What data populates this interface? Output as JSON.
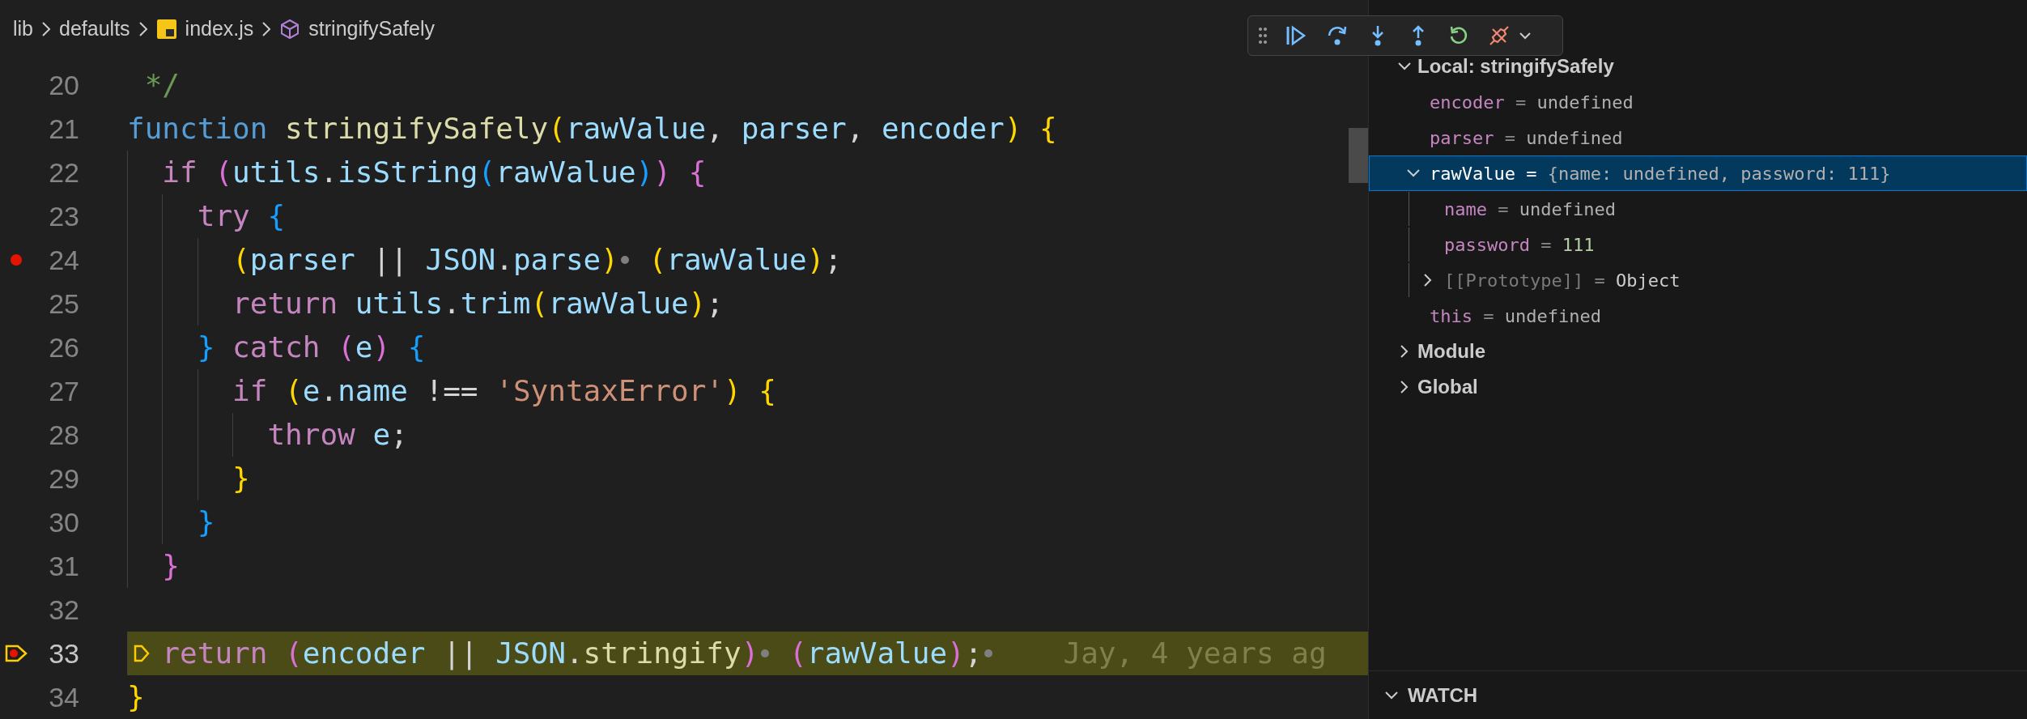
{
  "breadcrumbs": [
    {
      "kind": "folder",
      "label": "lib"
    },
    {
      "kind": "folder",
      "label": "defaults"
    },
    {
      "kind": "file",
      "label": "index.js"
    },
    {
      "kind": "symbol",
      "label": "stringifySafely"
    }
  ],
  "debug_toolbar": [
    {
      "kind": "continue"
    },
    {
      "kind": "step-over"
    },
    {
      "kind": "step-into"
    },
    {
      "kind": "step-out"
    },
    {
      "kind": "restart"
    },
    {
      "kind": "disconnect"
    }
  ],
  "editor": {
    "lines": [
      {
        "number": "20",
        "breakpoint": false,
        "current": false,
        "tokens": [
          {
            "kind": "comment",
            "text": " */"
          }
        ]
      },
      {
        "number": "21",
        "breakpoint": false,
        "current": false,
        "tokens": [
          {
            "kind": "keyword",
            "text": "function "
          },
          {
            "kind": "function",
            "text": "stringifySafely"
          },
          {
            "kind": "bracket-gold",
            "text": "("
          },
          {
            "kind": "variable",
            "text": "rawValue"
          },
          {
            "kind": "plain",
            "text": ", "
          },
          {
            "kind": "variable",
            "text": "parser"
          },
          {
            "kind": "plain",
            "text": ", "
          },
          {
            "kind": "variable",
            "text": "encoder"
          },
          {
            "kind": "bracket-gold",
            "text": ") {"
          }
        ]
      },
      {
        "number": "22",
        "breakpoint": false,
        "current": false,
        "tokens": [
          {
            "kind": "control",
            "text": "  if "
          },
          {
            "kind": "bracket-pink",
            "text": "("
          },
          {
            "kind": "variable",
            "text": "utils"
          },
          {
            "kind": "plain",
            "text": "."
          },
          {
            "kind": "variable",
            "text": "isString"
          },
          {
            "kind": "bracket-blue",
            "text": "("
          },
          {
            "kind": "variable",
            "text": "rawValue"
          },
          {
            "kind": "bracket-blue",
            "text": ")"
          },
          {
            "kind": "bracket-pink",
            "text": ") {"
          }
        ]
      },
      {
        "number": "23",
        "breakpoint": false,
        "current": false,
        "tokens": [
          {
            "kind": "control",
            "text": "    try "
          },
          {
            "kind": "bracket-blue",
            "text": "{"
          }
        ]
      },
      {
        "number": "24",
        "breakpoint": true,
        "current": false,
        "tokens": [
          {
            "kind": "bracket-gold",
            "text": "      ("
          },
          {
            "kind": "variable",
            "text": "parser"
          },
          {
            "kind": "plain",
            "text": " || "
          },
          {
            "kind": "variable",
            "text": "JSON"
          },
          {
            "kind": "plain",
            "text": "."
          },
          {
            "kind": "variable",
            "text": "parse"
          },
          {
            "kind": "bracket-gold",
            "text": ")"
          },
          {
            "kind": "inline-breakpoint"
          },
          {
            "kind": "bracket-gold",
            "text": " ("
          },
          {
            "kind": "variable",
            "text": "rawValue"
          },
          {
            "kind": "bracket-gold",
            "text": ")"
          },
          {
            "kind": "plain",
            "text": ";"
          }
        ]
      },
      {
        "number": "25",
        "breakpoint": false,
        "current": false,
        "tokens": [
          {
            "kind": "control",
            "text": "      return "
          },
          {
            "kind": "variable",
            "text": "utils"
          },
          {
            "kind": "plain",
            "text": "."
          },
          {
            "kind": "variable",
            "text": "trim"
          },
          {
            "kind": "bracket-gold",
            "text": "("
          },
          {
            "kind": "variable",
            "text": "rawValue"
          },
          {
            "kind": "bracket-gold",
            "text": ")"
          },
          {
            "kind": "plain",
            "text": ";"
          }
        ]
      },
      {
        "number": "26",
        "breakpoint": false,
        "current": false,
        "tokens": [
          {
            "kind": "bracket-blue",
            "text": "    } "
          },
          {
            "kind": "control",
            "text": "catch "
          },
          {
            "kind": "bracket-pink",
            "text": "("
          },
          {
            "kind": "variable",
            "text": "e"
          },
          {
            "kind": "bracket-pink",
            "text": ") "
          },
          {
            "kind": "bracket-blue",
            "text": "{"
          }
        ]
      },
      {
        "number": "27",
        "breakpoint": false,
        "current": false,
        "tokens": [
          {
            "kind": "control",
            "text": "      if "
          },
          {
            "kind": "bracket-gold",
            "text": "("
          },
          {
            "kind": "variable",
            "text": "e"
          },
          {
            "kind": "plain",
            "text": "."
          },
          {
            "kind": "variable",
            "text": "name"
          },
          {
            "kind": "plain",
            "text": " !== "
          },
          {
            "kind": "string",
            "text": "'SyntaxError'"
          },
          {
            "kind": "bracket-gold",
            "text": ") {"
          }
        ]
      },
      {
        "number": "28",
        "breakpoint": false,
        "current": false,
        "tokens": [
          {
            "kind": "control",
            "text": "        throw "
          },
          {
            "kind": "variable",
            "text": "e"
          },
          {
            "kind": "plain",
            "text": ";"
          }
        ]
      },
      {
        "number": "29",
        "breakpoint": false,
        "current": false,
        "tokens": [
          {
            "kind": "bracket-gold",
            "text": "      }"
          }
        ]
      },
      {
        "number": "30",
        "breakpoint": false,
        "current": false,
        "tokens": [
          {
            "kind": "bracket-blue",
            "text": "    }"
          }
        ]
      },
      {
        "number": "31",
        "breakpoint": false,
        "current": false,
        "tokens": [
          {
            "kind": "bracket-pink",
            "text": "  }"
          }
        ]
      },
      {
        "number": "32",
        "breakpoint": false,
        "current": false
      },
      {
        "number": "33",
        "breakpoint": true,
        "current": true,
        "blame": "Jay, 4 years ag",
        "tokens": [
          {
            "kind": "control",
            "text": "  return "
          },
          {
            "kind": "bracket-pink",
            "text": "("
          },
          {
            "kind": "variable",
            "text": "encoder"
          },
          {
            "kind": "plain",
            "text": " || "
          },
          {
            "kind": "variable",
            "text": "JSON"
          },
          {
            "kind": "plain",
            "text": "."
          },
          {
            "kind": "function",
            "text": "stringify"
          },
          {
            "kind": "bracket-pink",
            "text": ")"
          },
          {
            "kind": "inline-breakpoint"
          },
          {
            "kind": "bracket-pink",
            "text": " ("
          },
          {
            "kind": "variable",
            "text": "rawValue"
          },
          {
            "kind": "bracket-pink",
            "text": ")"
          },
          {
            "kind": "plain",
            "text": ";"
          },
          {
            "kind": "inline-breakpoint"
          }
        ]
      },
      {
        "number": "34",
        "breakpoint": false,
        "current": false,
        "tokens": [
          {
            "kind": "bracket-gold",
            "text": "}"
          }
        ]
      }
    ]
  },
  "variables": {
    "scopes": [
      {
        "label": "Local: stringifySafely",
        "expanded": true,
        "children": [
          {
            "kind": "variable",
            "name": "encoder",
            "separator": "=",
            "value": "undefined",
            "selected": false
          },
          {
            "kind": "variable",
            "name": "parser",
            "separator": "=",
            "value": "undefined",
            "selected": false
          },
          {
            "kind": "variable",
            "name": "rawValue",
            "separator": "=",
            "value": "{name: undefined, password: 111}",
            "expanded": true,
            "selected": true,
            "children": [
              {
                "kind": "variable",
                "name": "name",
                "separator": "=",
                "value": "undefined",
                "selected": false
              },
              {
                "kind": "number",
                "name": "password",
                "separator": "=",
                "value": "111",
                "selected": false
              },
              {
                "kind": "internal",
                "name": "[[Prototype]]",
                "separator": "=",
                "value": "Object",
                "expanded": false,
                "selected": false
              }
            ]
          },
          {
            "kind": "variable",
            "name": "this",
            "separator": "=",
            "value": "undefined",
            "selected": false
          }
        ]
      },
      {
        "label": "Module",
        "expanded": false
      },
      {
        "label": "Global",
        "expanded": false
      }
    ]
  },
  "watch": {
    "label": "WATCH",
    "expanded": true
  }
}
